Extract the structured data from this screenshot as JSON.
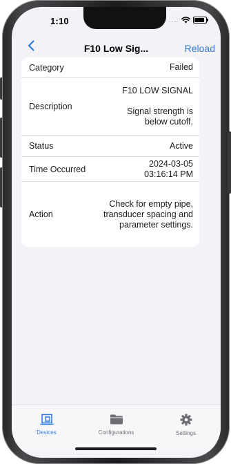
{
  "status_bar": {
    "time": "1:10",
    "signal": "....",
    "icons": [
      "wifi-icon",
      "battery-icon"
    ]
  },
  "nav": {
    "back_icon": "chevron-left-icon",
    "title": "F10 Low Sig...",
    "action": "Reload"
  },
  "details": {
    "rows": [
      {
        "label": "Category",
        "value": "Failed"
      },
      {
        "label": "Description",
        "value": "F10 LOW SIGNAL\n\nSignal strength is\nbelow cutoff."
      },
      {
        "label": "Status",
        "value": "Active"
      },
      {
        "label": "Time Occurred",
        "value": "2024-03-05\n03:16:14 PM"
      },
      {
        "label": "Action",
        "value": "Check for empty pipe, transducer spacing and parameter settings."
      }
    ]
  },
  "tabs": [
    {
      "label": "Devices",
      "icon": "devices-icon",
      "active": true
    },
    {
      "label": "Configurations",
      "icon": "folder-icon",
      "active": false
    },
    {
      "label": "Settings",
      "icon": "gear-icon",
      "active": false
    }
  ],
  "colors": {
    "accent": "#2f7bde",
    "background": "#f2f2f7",
    "inactive": "#6d6d72"
  }
}
